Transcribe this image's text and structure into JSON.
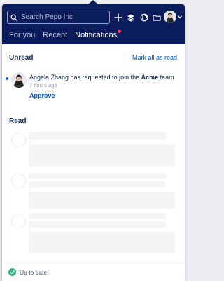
{
  "header": {
    "search_placeholder": "Search Pepo Inc",
    "icons": [
      "plus-icon",
      "layers-icon",
      "globe-icon",
      "folder-icon"
    ],
    "avatar_menu": "chevron-down-icon"
  },
  "tabs": [
    {
      "label": "For you",
      "active": false
    },
    {
      "label": "Recent",
      "active": false
    },
    {
      "label": "Notifications",
      "active": true,
      "has_indicator": true
    }
  ],
  "unread": {
    "title": "Unread",
    "mark_all_label": "Mark all as read",
    "notification": {
      "text_prefix": "Angela Zhang has requested to join the ",
      "team_name": "Acme",
      "text_suffix": " team",
      "time": "7 hours ago",
      "action_label": "Approve"
    }
  },
  "read": {
    "title": "Read",
    "placeholder_count": 3
  },
  "footer": {
    "status": "Up to date"
  },
  "colors": {
    "header_bg": "#0a1c5c",
    "accent": "#0052cc",
    "indicator": "#ff3b5c",
    "success": "#36b37e"
  }
}
